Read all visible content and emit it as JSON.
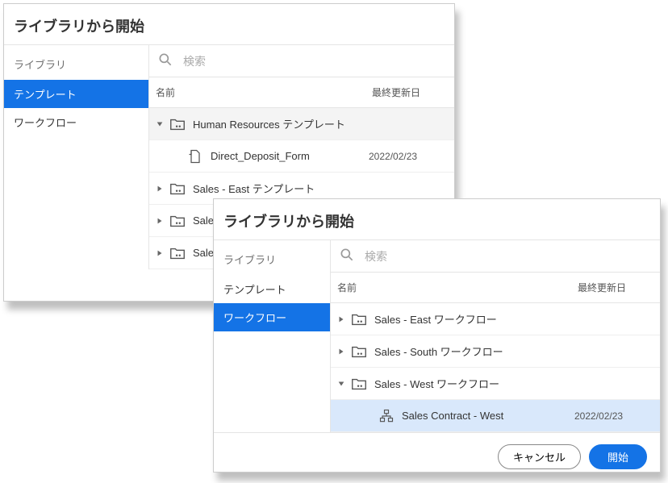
{
  "dialog1": {
    "title": "ライブラリから開始",
    "sidebar_title": "ライブラリ",
    "sidebar": {
      "templates": "テンプレート",
      "workflows": "ワークフロー"
    },
    "search_placeholder": "検索",
    "col_name": "名前",
    "col_date": "最終更新日",
    "rows": {
      "hr": "Human Resources テンプレート",
      "dd": "Direct_Deposit_Form",
      "dd_date": "2022/02/23",
      "se": "Sales - East テンプレート",
      "ss": "Sales - S",
      "sw": "Sales - W"
    }
  },
  "dialog2": {
    "title": "ライブラリから開始",
    "sidebar_title": "ライブラリ",
    "sidebar": {
      "templates": "テンプレート",
      "workflows": "ワークフロー"
    },
    "search_placeholder": "検索",
    "col_name": "名前",
    "col_date": "最終更新日",
    "rows": {
      "se": "Sales - East ワークフロー",
      "ss": "Sales - South ワークフロー",
      "sw": "Sales - West ワークフロー",
      "scw": "Sales Contract - West",
      "scw_date": "2022/02/23"
    },
    "buttons": {
      "cancel": "キャンセル",
      "start": "開始"
    }
  }
}
